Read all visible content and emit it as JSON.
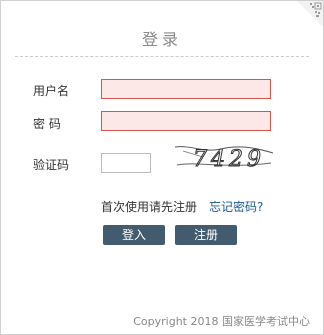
{
  "login": {
    "title": "登录",
    "username_label": "用户名",
    "password_label": "密 码",
    "captcha_label": "验证码",
    "username_value": "",
    "password_value": "",
    "captcha_value": "",
    "captcha_text": "7429",
    "first_time_text": "首次使用请先注册",
    "forgot_link": "忘记密码?",
    "login_button": "登入",
    "register_button": "注册"
  },
  "footer": {
    "copyright": "Copyright 2018 国家医学考试中心"
  },
  "icons": {
    "corner": "qr-code-icon"
  },
  "colors": {
    "button_bg": "#435b6f",
    "link": "#1a5a9a",
    "error_border": "#d9534f",
    "error_bg": "#fde8e8"
  }
}
